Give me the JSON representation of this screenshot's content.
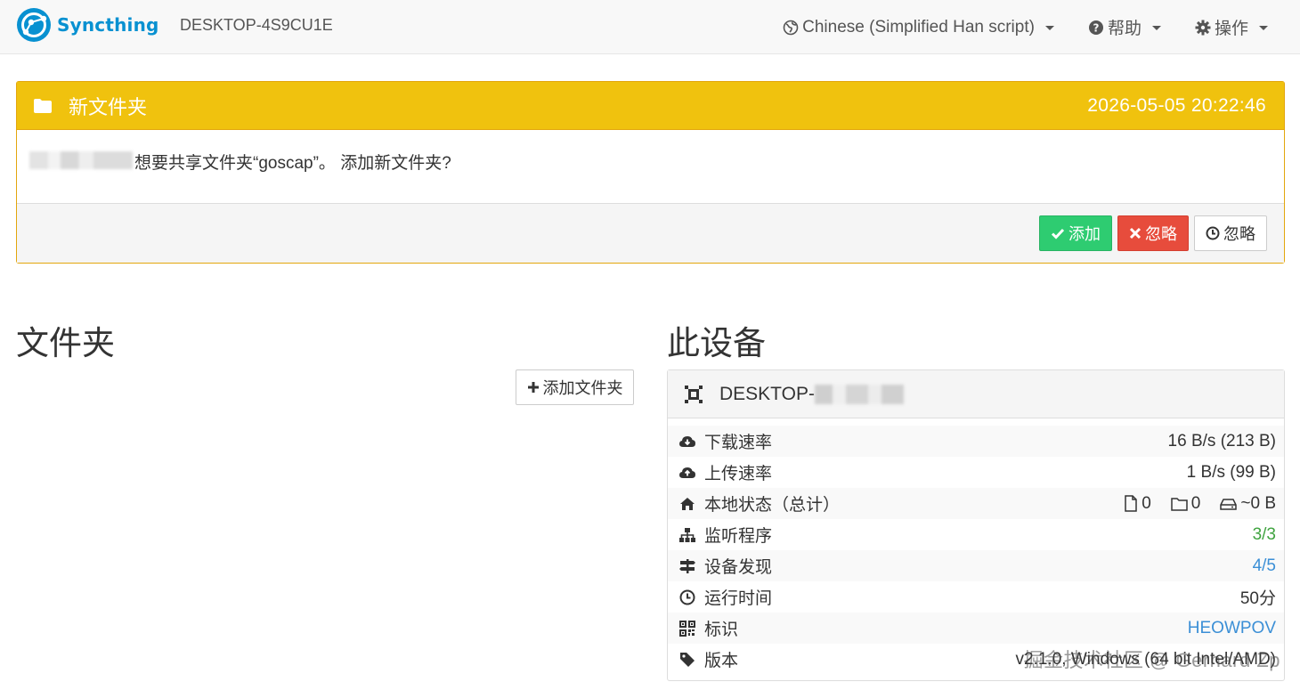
{
  "navbar": {
    "brand": "Syncthing",
    "hostname": "DESKTOP-4S9CU1E",
    "language": "Chinese (Simplified Han script)",
    "help": "帮助",
    "actions": "操作"
  },
  "notice": {
    "title": "新文件夹",
    "timestamp": "2026-05-05 20:22:46",
    "message": "想要共享文件夹“goscap”。 添加新文件夹?",
    "buttons": {
      "add": "添加",
      "ignore": "忽略",
      "dismiss": "忽略"
    }
  },
  "folders": {
    "heading": "文件夹",
    "add_button": "添加文件夹"
  },
  "device": {
    "heading": "此设备",
    "name": "DESKTOP-",
    "rows": [
      {
        "label": "下载速率",
        "value": "16 B/s (213 B)"
      },
      {
        "label": "上传速率",
        "value": "1 B/s (99 B)"
      },
      {
        "label": "本地状态（总计）",
        "files": "0",
        "dirs": "0",
        "size": "~0 B"
      },
      {
        "label": "监听程序",
        "value": "3/3"
      },
      {
        "label": "设备发现",
        "value": "4/5"
      },
      {
        "label": "运行时间",
        "value": "50分"
      },
      {
        "label": "标识",
        "value": "HEOWPOV"
      },
      {
        "label": "版本",
        "value": "v2.1.0, Windows (64 bit Intel/AMD)"
      }
    ]
  },
  "watermark": "掘金技术社区 @ Gerhard Zp",
  "colors": {
    "brand": "#0891d1",
    "warning": "#f0c20e",
    "success": "#2ecc71",
    "danger": "#e74c3c",
    "green_value": "#3fa33f",
    "blue_value": "#3b8fd6"
  }
}
